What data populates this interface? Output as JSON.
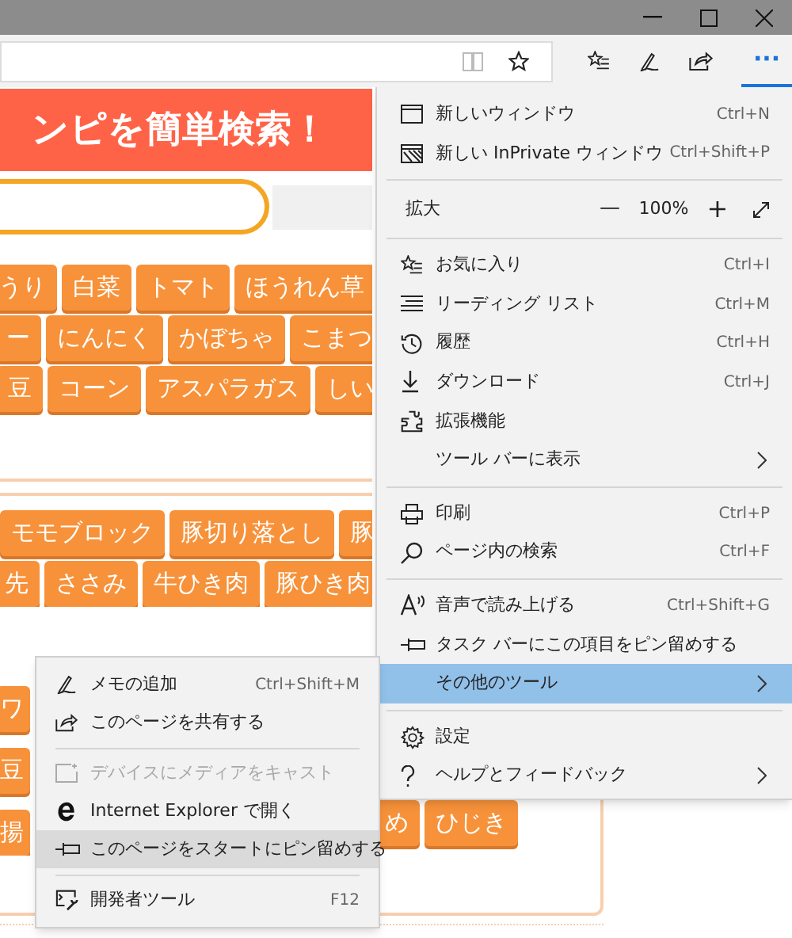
{
  "browser": {
    "more_button": {
      "label": "···",
      "selected": true
    }
  },
  "page": {
    "banner": "ンピを簡単検索！",
    "tag_rows": [
      [
        "うり",
        "白菜",
        "トマト",
        "ほうれん草"
      ],
      [
        "ー",
        "にんにく",
        "かぼちゃ",
        "こまつ"
      ],
      [
        "豆",
        "コーン",
        "アスパラガス",
        "しい"
      ],
      [
        "モモブロック",
        "豚切り落とし",
        "豚"
      ],
      [
        "先",
        "ささみ",
        "牛ひき肉",
        "豚ひき肉"
      ]
    ],
    "lower_left_tags": [
      "ワ",
      "豆",
      "揚"
    ],
    "lower_right_tags": [
      "め",
      "ひじき"
    ]
  },
  "menu": {
    "items": [
      {
        "kind": "item",
        "label": "新しいウィンドウ",
        "shortcut": "Ctrl+N",
        "selected": false,
        "submenu": false
      },
      {
        "kind": "item",
        "label": "新しい InPrivate ウィンドウ",
        "shortcut": "Ctrl+Shift+P",
        "selected": false,
        "submenu": false
      },
      {
        "kind": "separator"
      },
      {
        "kind": "zoom",
        "label": "拡大",
        "minus": "—",
        "value": "100%",
        "plus": "+"
      },
      {
        "kind": "separator"
      },
      {
        "kind": "item",
        "label": "お気に入り",
        "shortcut": "Ctrl+I",
        "selected": false,
        "submenu": false
      },
      {
        "kind": "item",
        "label": "リーディング リスト",
        "shortcut": "Ctrl+M",
        "selected": false,
        "submenu": false
      },
      {
        "kind": "item",
        "label": "履歴",
        "shortcut": "Ctrl+H",
        "selected": false,
        "submenu": false
      },
      {
        "kind": "item",
        "label": "ダウンロード",
        "shortcut": "Ctrl+J",
        "selected": false,
        "submenu": false
      },
      {
        "kind": "item",
        "label": "拡張機能",
        "selected": false,
        "submenu": false
      },
      {
        "kind": "item",
        "label": "ツール バーに表示",
        "selected": false,
        "submenu": true
      },
      {
        "kind": "separator"
      },
      {
        "kind": "item",
        "label": "印刷",
        "shortcut": "Ctrl+P",
        "selected": false,
        "submenu": false
      },
      {
        "kind": "item",
        "label": "ページ内の検索",
        "shortcut": "Ctrl+F",
        "selected": false,
        "submenu": false
      },
      {
        "kind": "separator"
      },
      {
        "kind": "item",
        "label": "音声で読み上げる",
        "shortcut": "Ctrl+Shift+G",
        "selected": false,
        "submenu": false
      },
      {
        "kind": "item",
        "label": "タスク バーにこの項目をピン留めする",
        "selected": false,
        "submenu": false
      },
      {
        "kind": "item",
        "label": "その他のツール",
        "selected": true,
        "submenu": true
      },
      {
        "kind": "separator"
      },
      {
        "kind": "item",
        "label": "設定",
        "selected": false,
        "submenu": false
      },
      {
        "kind": "item",
        "label": "ヘルプとフィードバック",
        "selected": false,
        "submenu": true
      }
    ]
  },
  "submenu": {
    "items": [
      {
        "kind": "item",
        "label": "メモの追加",
        "shortcut": "Ctrl+Shift+M",
        "selected": false,
        "disabled": false
      },
      {
        "kind": "item",
        "label": "このページを共有する",
        "selected": false,
        "disabled": false
      },
      {
        "kind": "separator"
      },
      {
        "kind": "item",
        "label": "デバイスにメディアをキャスト",
        "selected": false,
        "disabled": true
      },
      {
        "kind": "item",
        "label": "Internet Explorer で開く",
        "selected": false,
        "disabled": false
      },
      {
        "kind": "item",
        "label": "このページをスタートにピン留めする",
        "selected": true,
        "disabled": false
      },
      {
        "kind": "separator"
      },
      {
        "kind": "item",
        "label": "開発者ツール",
        "shortcut": "F12",
        "selected": false,
        "disabled": false
      }
    ]
  }
}
